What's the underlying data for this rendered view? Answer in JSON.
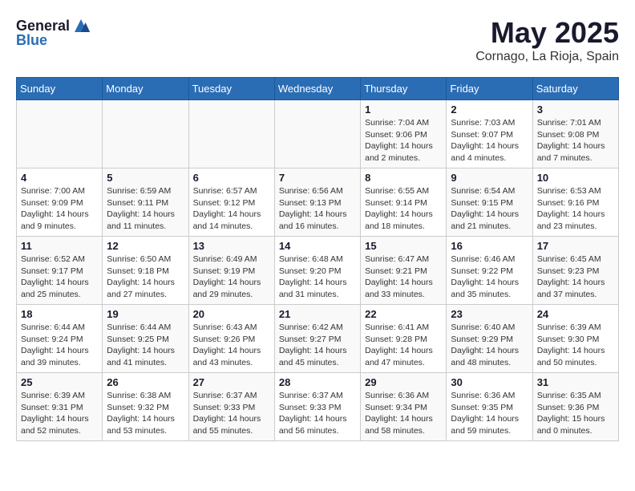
{
  "header": {
    "logo_general": "General",
    "logo_blue": "Blue",
    "month": "May 2025",
    "location": "Cornago, La Rioja, Spain"
  },
  "days_of_week": [
    "Sunday",
    "Monday",
    "Tuesday",
    "Wednesday",
    "Thursday",
    "Friday",
    "Saturday"
  ],
  "weeks": [
    [
      {
        "day": "",
        "info": ""
      },
      {
        "day": "",
        "info": ""
      },
      {
        "day": "",
        "info": ""
      },
      {
        "day": "",
        "info": ""
      },
      {
        "day": "1",
        "info": "Sunrise: 7:04 AM\nSunset: 9:06 PM\nDaylight: 14 hours\nand 2 minutes."
      },
      {
        "day": "2",
        "info": "Sunrise: 7:03 AM\nSunset: 9:07 PM\nDaylight: 14 hours\nand 4 minutes."
      },
      {
        "day": "3",
        "info": "Sunrise: 7:01 AM\nSunset: 9:08 PM\nDaylight: 14 hours\nand 7 minutes."
      }
    ],
    [
      {
        "day": "4",
        "info": "Sunrise: 7:00 AM\nSunset: 9:09 PM\nDaylight: 14 hours\nand 9 minutes."
      },
      {
        "day": "5",
        "info": "Sunrise: 6:59 AM\nSunset: 9:11 PM\nDaylight: 14 hours\nand 11 minutes."
      },
      {
        "day": "6",
        "info": "Sunrise: 6:57 AM\nSunset: 9:12 PM\nDaylight: 14 hours\nand 14 minutes."
      },
      {
        "day": "7",
        "info": "Sunrise: 6:56 AM\nSunset: 9:13 PM\nDaylight: 14 hours\nand 16 minutes."
      },
      {
        "day": "8",
        "info": "Sunrise: 6:55 AM\nSunset: 9:14 PM\nDaylight: 14 hours\nand 18 minutes."
      },
      {
        "day": "9",
        "info": "Sunrise: 6:54 AM\nSunset: 9:15 PM\nDaylight: 14 hours\nand 21 minutes."
      },
      {
        "day": "10",
        "info": "Sunrise: 6:53 AM\nSunset: 9:16 PM\nDaylight: 14 hours\nand 23 minutes."
      }
    ],
    [
      {
        "day": "11",
        "info": "Sunrise: 6:52 AM\nSunset: 9:17 PM\nDaylight: 14 hours\nand 25 minutes."
      },
      {
        "day": "12",
        "info": "Sunrise: 6:50 AM\nSunset: 9:18 PM\nDaylight: 14 hours\nand 27 minutes."
      },
      {
        "day": "13",
        "info": "Sunrise: 6:49 AM\nSunset: 9:19 PM\nDaylight: 14 hours\nand 29 minutes."
      },
      {
        "day": "14",
        "info": "Sunrise: 6:48 AM\nSunset: 9:20 PM\nDaylight: 14 hours\nand 31 minutes."
      },
      {
        "day": "15",
        "info": "Sunrise: 6:47 AM\nSunset: 9:21 PM\nDaylight: 14 hours\nand 33 minutes."
      },
      {
        "day": "16",
        "info": "Sunrise: 6:46 AM\nSunset: 9:22 PM\nDaylight: 14 hours\nand 35 minutes."
      },
      {
        "day": "17",
        "info": "Sunrise: 6:45 AM\nSunset: 9:23 PM\nDaylight: 14 hours\nand 37 minutes."
      }
    ],
    [
      {
        "day": "18",
        "info": "Sunrise: 6:44 AM\nSunset: 9:24 PM\nDaylight: 14 hours\nand 39 minutes."
      },
      {
        "day": "19",
        "info": "Sunrise: 6:44 AM\nSunset: 9:25 PM\nDaylight: 14 hours\nand 41 minutes."
      },
      {
        "day": "20",
        "info": "Sunrise: 6:43 AM\nSunset: 9:26 PM\nDaylight: 14 hours\nand 43 minutes."
      },
      {
        "day": "21",
        "info": "Sunrise: 6:42 AM\nSunset: 9:27 PM\nDaylight: 14 hours\nand 45 minutes."
      },
      {
        "day": "22",
        "info": "Sunrise: 6:41 AM\nSunset: 9:28 PM\nDaylight: 14 hours\nand 47 minutes."
      },
      {
        "day": "23",
        "info": "Sunrise: 6:40 AM\nSunset: 9:29 PM\nDaylight: 14 hours\nand 48 minutes."
      },
      {
        "day": "24",
        "info": "Sunrise: 6:39 AM\nSunset: 9:30 PM\nDaylight: 14 hours\nand 50 minutes."
      }
    ],
    [
      {
        "day": "25",
        "info": "Sunrise: 6:39 AM\nSunset: 9:31 PM\nDaylight: 14 hours\nand 52 minutes."
      },
      {
        "day": "26",
        "info": "Sunrise: 6:38 AM\nSunset: 9:32 PM\nDaylight: 14 hours\nand 53 minutes."
      },
      {
        "day": "27",
        "info": "Sunrise: 6:37 AM\nSunset: 9:33 PM\nDaylight: 14 hours\nand 55 minutes."
      },
      {
        "day": "28",
        "info": "Sunrise: 6:37 AM\nSunset: 9:33 PM\nDaylight: 14 hours\nand 56 minutes."
      },
      {
        "day": "29",
        "info": "Sunrise: 6:36 AM\nSunset: 9:34 PM\nDaylight: 14 hours\nand 58 minutes."
      },
      {
        "day": "30",
        "info": "Sunrise: 6:36 AM\nSunset: 9:35 PM\nDaylight: 14 hours\nand 59 minutes."
      },
      {
        "day": "31",
        "info": "Sunrise: 6:35 AM\nSunset: 9:36 PM\nDaylight: 15 hours\nand 0 minutes."
      }
    ]
  ]
}
